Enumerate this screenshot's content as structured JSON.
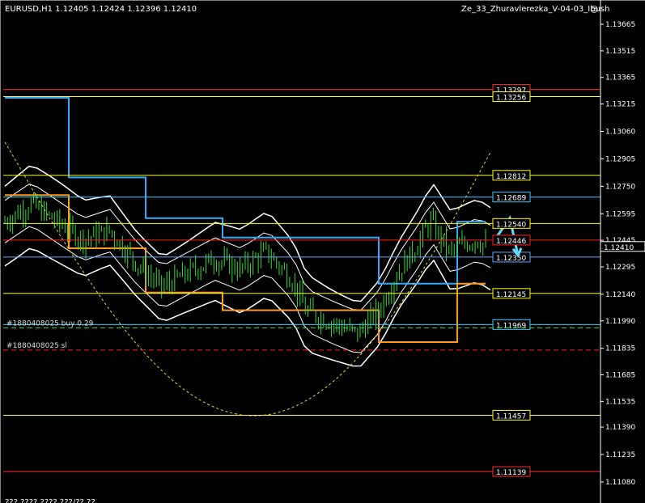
{
  "header": {
    "symbol_line": "EURUSD,H1  1.12405  1.12424  1.12396  1.12410",
    "indicator_name": "Ze_33_Zhuravlerezka_V-04-03_Ibush",
    "smiley": "☺"
  },
  "chart_data": {
    "type": "candlestick",
    "ylim": [
      1.1103,
      1.1372
    ],
    "y_ticks": [
      "1.13665",
      "1.13515",
      "1.13365",
      "1.13215",
      "1.13060",
      "1.12905",
      "1.12750",
      "1.12595",
      "1.12445",
      "1.12295",
      "1.12140",
      "1.11990",
      "1.11835",
      "1.11685",
      "1.11535",
      "1.11390",
      "1.11235",
      "1.11080"
    ],
    "current_price": "1.12410",
    "levels": [
      {
        "price": 1.13297,
        "label": "1.13297",
        "color": "#ff2a2a"
      },
      {
        "price": 1.13256,
        "label": "1.13256",
        "color": "#ffff33"
      },
      {
        "price": 1.12812,
        "label": "1.12812",
        "color": "#ffff00"
      },
      {
        "price": 1.12689,
        "label": "1.12689",
        "color": "#33ccff"
      },
      {
        "price": 1.1254,
        "label": "1.12540",
        "color": "#ffff00"
      },
      {
        "price": 1.12446,
        "label": "1.12446",
        "color": "#ff2020"
      },
      {
        "price": 1.1235,
        "label": "1.12350",
        "color": "#5aaaff"
      },
      {
        "price": 1.12145,
        "label": "1.12145",
        "color": "#ffff00"
      },
      {
        "price": 1.11969,
        "label": "1.11969",
        "color": "#33ccff"
      },
      {
        "price": 1.11457,
        "label": "1.11457",
        "color": "#ffff33"
      },
      {
        "price": 1.11139,
        "label": "1.11139",
        "color": "#ff2a2a"
      }
    ],
    "orders": [
      {
        "label": "#1880408025 buy 0.29",
        "price": 1.1195,
        "color": "#33cc33"
      },
      {
        "label": "#1880408025 sl",
        "price": 1.11825,
        "color": "#ff2020"
      }
    ],
    "bottom_label": "??? ???? ???? ???/?? ??"
  }
}
